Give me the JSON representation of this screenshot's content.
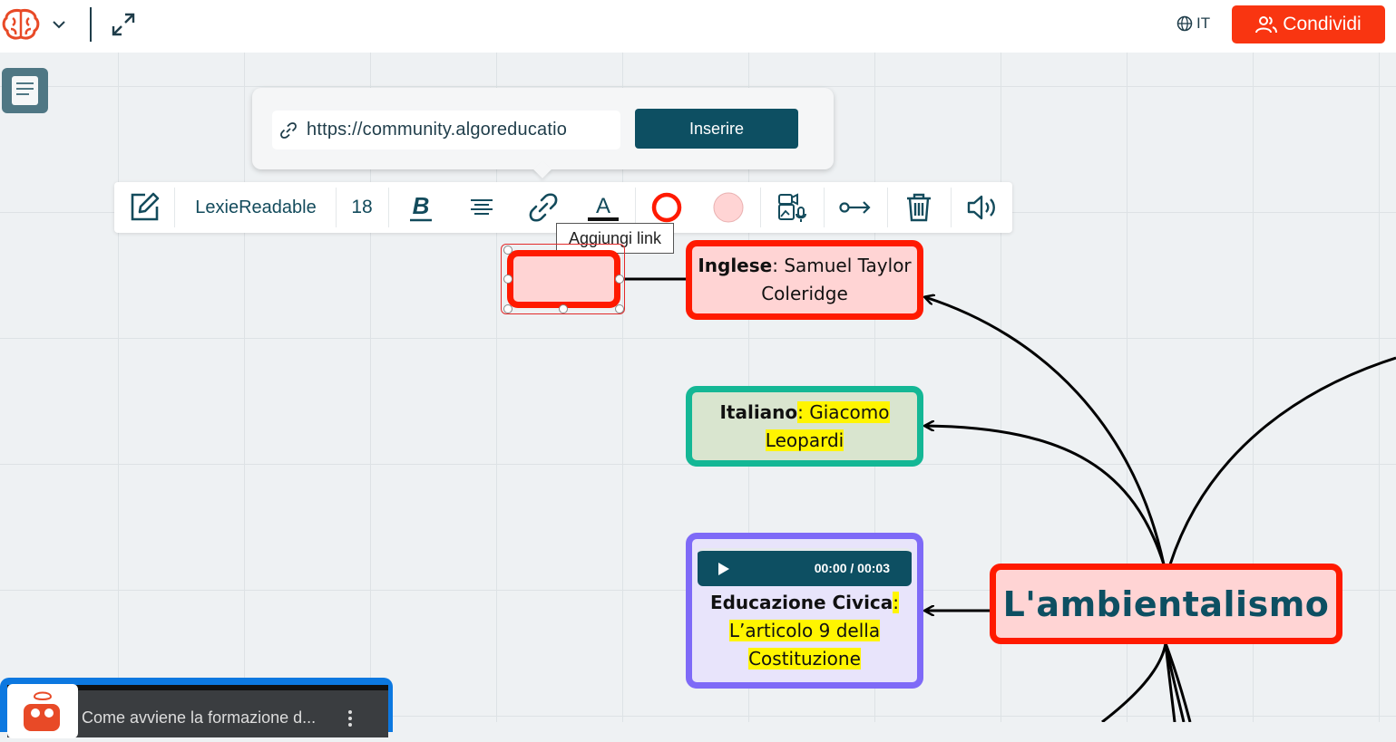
{
  "topbar": {
    "logo_icon": "brain-logo-icon",
    "language_label": "IT",
    "share_label": "Condividi",
    "share_color": "#f93511"
  },
  "link_popup": {
    "url_value": "https://community.algoreducatio",
    "insert_label": "Inserire"
  },
  "toolbar": {
    "font_name": "LexieReadable",
    "font_size": "18",
    "tooltip": "Aggiungi link"
  },
  "nodes": {
    "english": {
      "label_bold": "Inglese",
      "label_rest": ": Samuel Taylor Coleridge",
      "border": "#ff1a00",
      "fill": "#ffd4d4"
    },
    "italian": {
      "label_bold": "Italiano",
      "label_rest_1": ": Giacomo",
      "label_rest_2": "Leopardi",
      "border": "#14b795",
      "fill": "#d9e5cf"
    },
    "civics": {
      "audio_time": "00:00 / 00:03",
      "label_bold": "Educazione Civica",
      "label_line_2": "L’articolo 9 della",
      "label_line_3": "Costituzione",
      "border": "#7e6af7",
      "fill": "#e8e4fb"
    },
    "main": {
      "label": "L'ambientalismo",
      "border": "#ff1a00",
      "fill": "#ffd4d4",
      "text_color": "#0d4f62"
    }
  },
  "video": {
    "title": "Come avviene la formazione d..."
  }
}
